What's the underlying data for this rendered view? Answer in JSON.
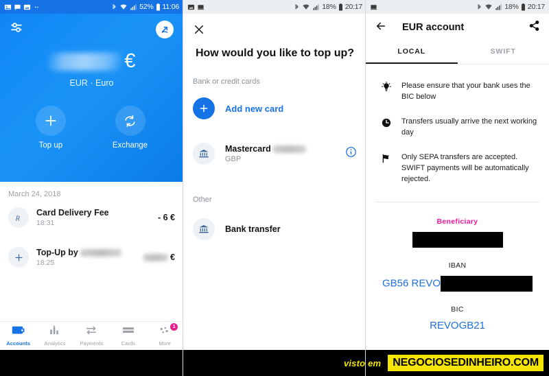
{
  "left": {
    "statusbar": {
      "icons": [
        "image-icon",
        "message-icon",
        "photo-icon",
        "more-dots-icon"
      ],
      "bluetooth": "bluetooth-icon",
      "wifi": "wifi-icon",
      "signal": "signal-icon",
      "battery_pct": "52%",
      "battery": "battery-icon",
      "time": "11:06"
    },
    "toolbar": {
      "settings_icon": "sliders-icon",
      "profile_icon": "profile-arrow-icon"
    },
    "balance": {
      "amount_redacted": true,
      "currency_symbol": "€",
      "currency_code": "EUR · Euro"
    },
    "actions": [
      {
        "label": "Top up",
        "icon": "plus-icon"
      },
      {
        "label": "Exchange",
        "icon": "exchange-icon"
      }
    ],
    "transactions": {
      "date_header": "March 24, 2018",
      "items": [
        {
          "icon": "revolut-r-icon",
          "title": "Card Delivery Fee",
          "title_redacted": false,
          "time": "18:31",
          "amount": "- 6 €",
          "amount_redacted": false
        },
        {
          "icon": "plus-icon",
          "title": "Top-Up by",
          "title_redacted": true,
          "time": "18:25",
          "amount": "€",
          "amount_redacted": true
        }
      ]
    },
    "bottomnav": [
      {
        "label": "Accounts",
        "icon": "wallet-icon",
        "active": true,
        "badge": ""
      },
      {
        "label": "Analytics",
        "icon": "bars-icon",
        "active": false,
        "badge": ""
      },
      {
        "label": "Payments",
        "icon": "transfer-icon",
        "active": false,
        "badge": ""
      },
      {
        "label": "Cards",
        "icon": "card-icon",
        "active": false,
        "badge": ""
      },
      {
        "label": "More",
        "icon": "dots-icon",
        "active": false,
        "badge": "1"
      }
    ]
  },
  "middle": {
    "statusbar": {
      "icons": [
        "image-icon",
        "screen-icon"
      ],
      "battery_pct": "18%",
      "time": "20:17"
    },
    "close_icon": "close-icon",
    "title": "How would you like to top up?",
    "sections": [
      {
        "heading": "Bank or credit cards",
        "rows": [
          {
            "icon": "plus-icon",
            "style": "link",
            "label": "Add new card",
            "sub": "",
            "redacted": false,
            "trailing_icon": ""
          },
          {
            "icon": "bank-icon",
            "style": "item",
            "label": "Mastercard",
            "sub": "GBP",
            "redacted": true,
            "trailing_icon": "info-icon"
          }
        ]
      },
      {
        "heading": "Other",
        "rows": [
          {
            "icon": "bank-icon",
            "style": "item",
            "label": "Bank transfer",
            "sub": "",
            "redacted": false,
            "trailing_icon": ""
          }
        ]
      }
    ]
  },
  "right": {
    "statusbar": {
      "icons": [
        "screen-icon"
      ],
      "battery_pct": "18%",
      "time": "20:17"
    },
    "appbar": {
      "back_icon": "back-arrow-icon",
      "title": "EUR account",
      "share_icon": "share-icon"
    },
    "tabs": [
      {
        "label": "LOCAL",
        "active": true
      },
      {
        "label": "SWIFT",
        "active": false
      }
    ],
    "info": [
      {
        "icon": "lightbulb-icon",
        "text": "Please ensure that your bank uses the BIC below"
      },
      {
        "icon": "clock-icon",
        "text": "Transfers usually arrive the next working day"
      },
      {
        "icon": "flag-icon",
        "text": "Only SEPA transfers are accepted. SWIFT payments will be automatically rejected."
      }
    ],
    "fields": [
      {
        "label": "Beneficiary",
        "label_color": "pink",
        "value": "",
        "redacted": true,
        "redact_width": 132
      },
      {
        "label": "IBAN",
        "label_color": "plain",
        "value": "GB56 REVO",
        "redacted": true,
        "redact_width": 148
      },
      {
        "label": "BIC",
        "label_color": "plain",
        "value": "REVOGB21",
        "redacted": false,
        "redact_width": 0
      }
    ]
  },
  "watermark": {
    "prefix": "visto em",
    "site": "NEGOCIOSEDINHEIRO.COM",
    "bg": "#000000",
    "accent": "#f5e500"
  }
}
